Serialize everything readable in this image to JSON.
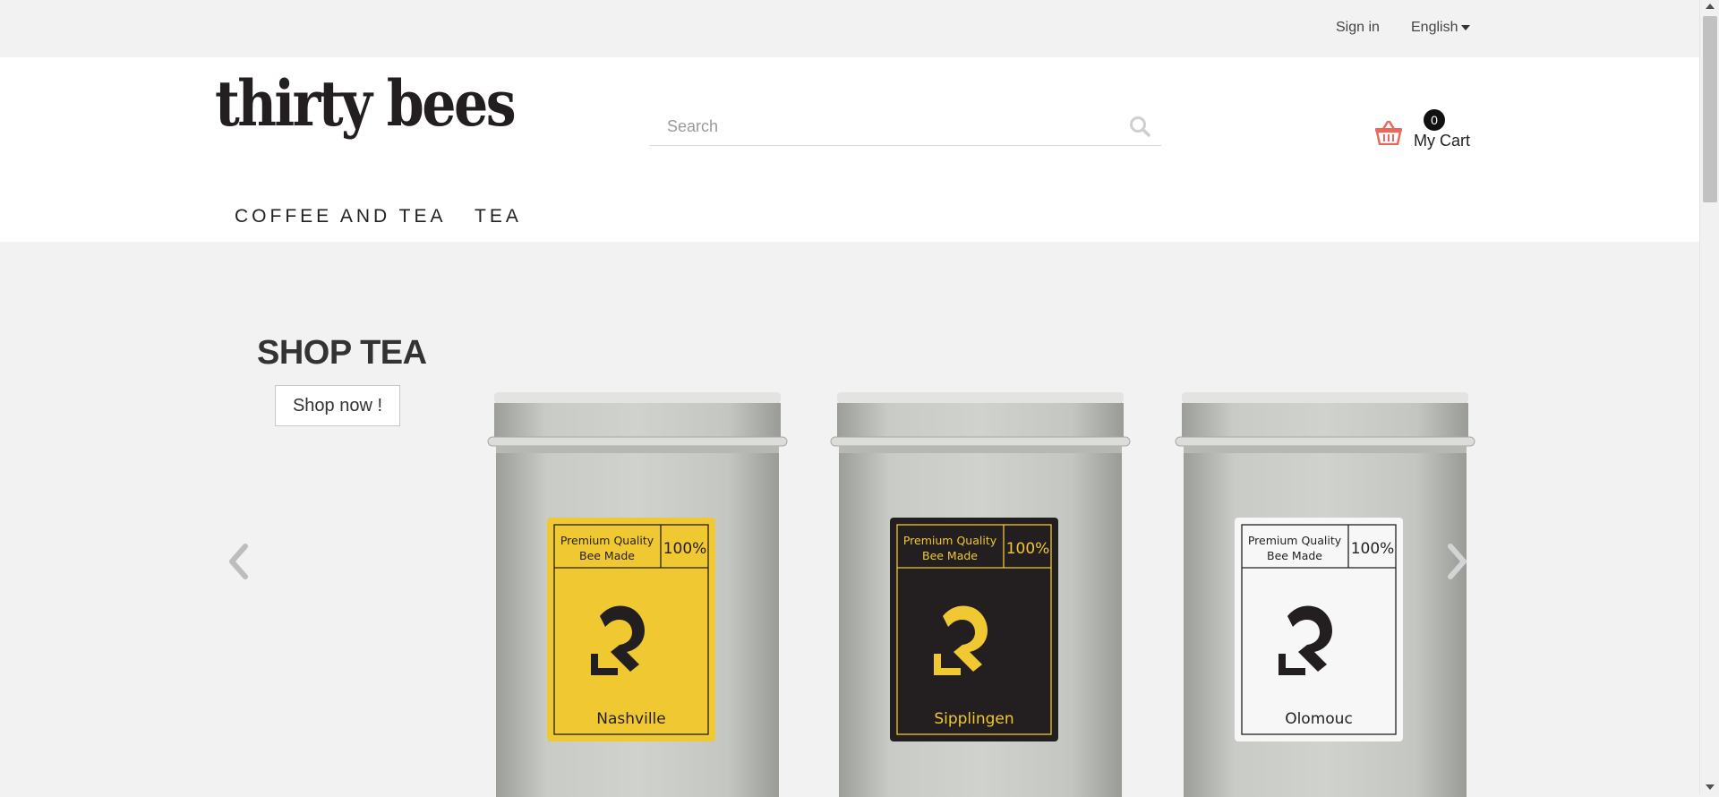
{
  "topbar": {
    "signin_label": "Sign in",
    "language": "English"
  },
  "header": {
    "logo_text": "thirty bees",
    "search": {
      "placeholder": "Search",
      "value": ""
    },
    "cart": {
      "label": "My Cart",
      "count": "0"
    }
  },
  "nav": {
    "items": [
      {
        "label": "COFFEE AND TEA"
      },
      {
        "label": "TEA"
      }
    ]
  },
  "slider": {
    "title": "SHOP TEA",
    "button_label": "Shop now !",
    "products": [
      {
        "quality_line1": "Premium Quality",
        "quality_line2": "Bee Made",
        "percent": "100%",
        "name": "Nashville",
        "label_color": "#f0c832",
        "ink_color": "#231f20"
      },
      {
        "quality_line1": "Premium Quality",
        "quality_line2": "Bee Made",
        "percent": "100%",
        "name": "Sipplingen",
        "label_color": "#231f20",
        "ink_color": "#f0c832"
      },
      {
        "quality_line1": "Premium Quality",
        "quality_line2": "Bee Made",
        "percent": "100%",
        "name": "Olomouc",
        "label_color": "#f7f7f7",
        "ink_color": "#231f20"
      }
    ]
  },
  "colors": {
    "accent": "#e8695b",
    "background": "#f2f2f2",
    "header_bg": "#ffffff"
  }
}
